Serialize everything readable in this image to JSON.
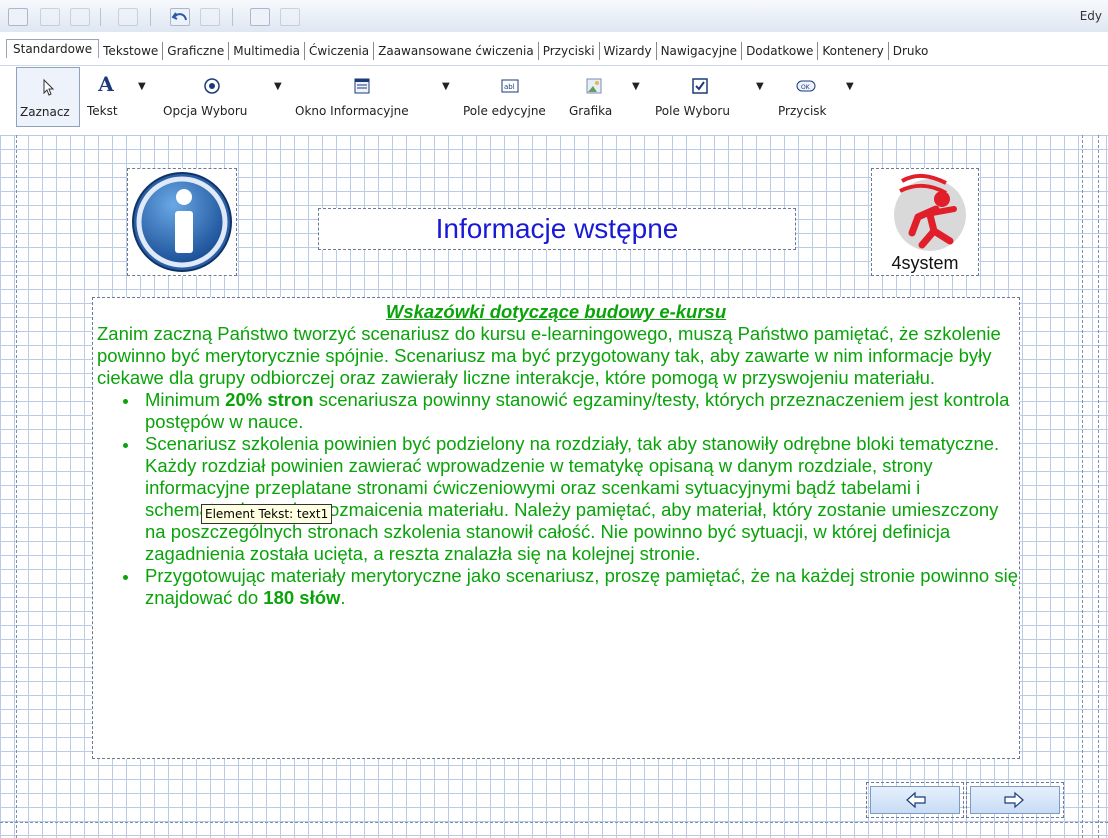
{
  "topbar": {
    "corner_text": "Edy",
    "icons": [
      "edit-icon",
      "cut-icon",
      "copy-icon",
      "paste-icon",
      "undo-icon",
      "redo-icon",
      "print-icon",
      "preview-icon"
    ]
  },
  "tabs": [
    {
      "label": "Standardowe",
      "active": true
    },
    {
      "label": "Tekstowe"
    },
    {
      "label": "Graficzne"
    },
    {
      "label": "Multimedia"
    },
    {
      "label": "Ćwiczenia"
    },
    {
      "label": "Zaawansowane ćwiczenia"
    },
    {
      "label": "Przyciski"
    },
    {
      "label": "Wizardy"
    },
    {
      "label": "Nawigacyjne"
    },
    {
      "label": "Dodatkowe"
    },
    {
      "label": "Kontenery"
    },
    {
      "label": "Druko"
    }
  ],
  "toolbar": {
    "zaznacz": "Zaznacz",
    "tekst": "Tekst",
    "opcja": "Opcja Wyboru",
    "okno": "Okno Informacyjne",
    "pole_edycyjne": "Pole edycyjne",
    "grafika": "Grafika",
    "pole_wyboru": "Pole Wyboru",
    "przycisk": "Przycisk",
    "field_text": "abl",
    "button_text": "OK"
  },
  "page": {
    "title": "Informacje wstępne",
    "logo_text": "4system",
    "heading": "Wskazówki dotyczące budowy e-kursu",
    "intro": "Zanim zaczną Państwo tworzyć scenariusz do kursu e-learningowego, muszą Państwo pamiętać, że szkolenie powinno być merytorycznie spójnie. Scenariusz ma być przygotowany tak, aby zawarte w nim informacje były ciekawe dla grupy odbiorczej oraz zawierały liczne interakcje, które pomogą w przyswojeniu materiału.",
    "b1_pre": "Minimum ",
    "b1_bold": "20% stron",
    "b1_post": " scenariusza powinny stanowić egzaminy/testy, których przeznaczeniem jest kontrola postępów w nauce.",
    "b2": "Scenariusz szkolenia powinien być podzielony na rozdziały, tak aby stanowiły odrębne bloki tematyczne. Każdy rozdział powinien zawierać wprowadzenie w tematykę opisaną w danym rozdziale, strony informacyjne przeplatane stronami ćwiczeniowymi oraz scenkami sytuacyjnymi bądź tabelami i schematami, w celu urozmaicenia materiału. Należy pamiętać, aby materiał, który zostanie umieszczony na poszczególnych stronach szkolenia stanowił całość. Nie powinno być sytuacji, w której definicja zagadnienia została ucięta, a reszta znalazła się na kolejnej stronie.",
    "b3_pre": "Przygotowując materiały merytoryczne jako scenariusz, proszę pamiętać, że na każdej stronie powinno się znajdować do ",
    "b3_bold": "180 słów",
    "b3_post": ".",
    "tooltip": "Element Tekst: text1"
  },
  "colors": {
    "text_green": "#0aa30a",
    "title_blue": "#1a1ad6",
    "grid": "#b9cbe6"
  }
}
